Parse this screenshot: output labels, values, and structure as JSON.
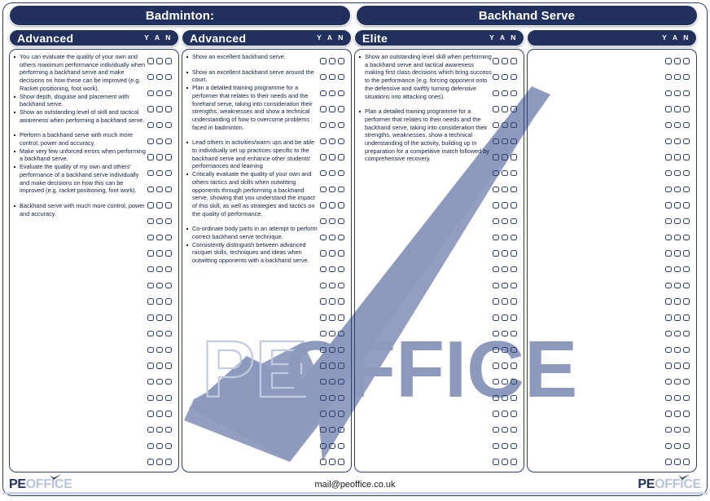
{
  "header": {
    "title_left": "Badminton:",
    "title_right": "Backhand Serve"
  },
  "yan_label": "Y A N",
  "colors": {
    "navy": "#22305e",
    "border": "#2a3f6e",
    "watermark_fill": "#8d99bd",
    "watermark_outline": "#c3cbe2",
    "logo_light": "#b8c4de"
  },
  "columns": [
    {
      "level": "Advanced",
      "yan": "Y A N",
      "rows": 26,
      "criteria": [
        {
          "text": "You can evaluate the quality of your own and others maximum performance individually when performing a backhand serve and make decisions on how these can be improved (e.g. Racket positioning, foot work).",
          "gap": false
        },
        {
          "text": "Show depth, disguise and placement with backhand serve.",
          "gap": false
        },
        {
          "text": "Show an outstanding level of skill and tactical awareness when performing a backhand serve.",
          "gap": false
        },
        {
          "text": "Perform a backhand serve with much more control, power and accuracy.",
          "gap": true
        },
        {
          "text": "Make very few unforced errors when performing a backhand serve.",
          "gap": false
        },
        {
          "text": "Evaluate the quality of my own and others' performance of a backhand serve individually and make decisions on how this can be improved (e.g. racket positioning, foot work).",
          "gap": false
        },
        {
          "text": "Backhand serve with much more control, power and accuracy.",
          "gap": true
        }
      ]
    },
    {
      "level": "Advanced",
      "yan": "Y A N",
      "rows": 26,
      "criteria": [
        {
          "text": "Show an excellent backhand serve.",
          "gap": false
        },
        {
          "text": "Show an excellent backhand serve around the court.",
          "gap": true
        },
        {
          "text": "Plan a detailed training programme for a performer that relates to their needs and the forehand serve, taking into consideration their strengths, weaknesses and show a technical understanding of how to overcome problems faced in badminton.",
          "gap": false
        },
        {
          "text": "Lead others in activities/warm ups and be able to individually set up practices specific to the backhand serve and enhance other students' performances and learning",
          "gap": true
        },
        {
          "text": "Critically evaluate the quality of your own and others tactics and skills when outwitting opponents through performing a backhand serve, showing that you understand the impact of this skill, as well as strategies and tactics on the quality of performance.",
          "gap": false
        },
        {
          "text": "Co-ordinate body parts in an attempt to perform correct backhand serve technique.",
          "gap": true
        },
        {
          "text": "Consistently distinguish between advanced racquet skills, techniques and ideas when outwitting opponents with a backhand serve.",
          "gap": false
        }
      ]
    },
    {
      "level": "Elite",
      "yan": "Y A N",
      "rows": 26,
      "criteria": [
        {
          "text": "Show an outstanding level skill when performing a backhand serve and tactical awareness making first class decisions which bring success to the performance (e.g. forcing opponent onto the defensive and swiftly turning defensive situations into attacking ones).",
          "gap": false
        },
        {
          "text": "Plan a detailed training programme for a performer that relates to their needs and the backhand serve, taking into consideration their strengths, weaknesses, show a technical understanding of the activity, building up in preparation for a competitive match followed by comprehensive recovery.",
          "gap": true
        }
      ]
    },
    {
      "level": "",
      "yan": "Y A N",
      "rows": 26,
      "criteria": []
    }
  ],
  "footer": {
    "logo_pe": "PE",
    "logo_office": "OFFICE",
    "email": "mail@peoffice.co.uk"
  },
  "watermark": {
    "pe": "PE",
    "office": "OFFICE"
  }
}
